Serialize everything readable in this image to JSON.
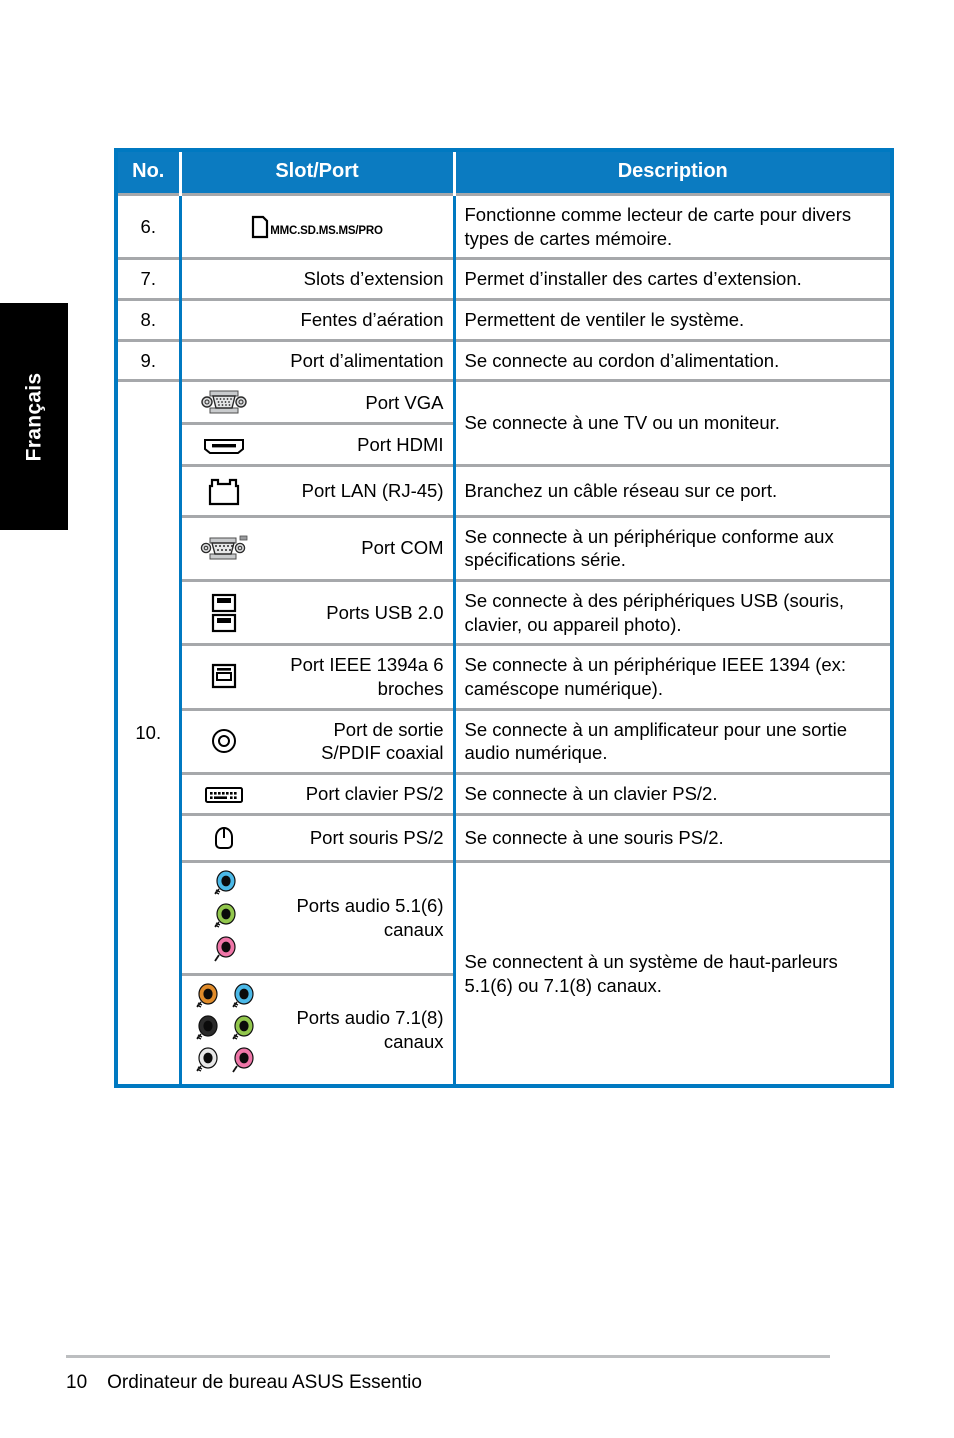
{
  "language_tab": {
    "label": "Français"
  },
  "table": {
    "headers": {
      "no": "No.",
      "slot_port": "Slot/Port",
      "description": "Description"
    },
    "accent_color": "#0079c1",
    "header_bg": "#0b7bc1",
    "divider_color": "#a6a8ab",
    "rows": [
      {
        "no": "6.",
        "icon": "memory-card-icon",
        "slot_port": "MMC.SD.MS.MS/PRO",
        "description": "Fonctionne comme lecteur de carte pour divers types de cartes mémoire."
      },
      {
        "no": "7.",
        "slot_port": "Slots d’extension",
        "description": "Permet d’installer des cartes d’extension."
      },
      {
        "no": "8.",
        "slot_port": "Fentes d’aération",
        "description": "Permettent de ventiler le système."
      },
      {
        "no": "9.",
        "slot_port": "Port d’alimentation",
        "description": "Se connecte au cordon d’alimentation."
      }
    ],
    "group_10": {
      "no": "10.",
      "ports": [
        {
          "icon": "vga-port-icon",
          "label": "Port VGA"
        },
        {
          "icon": "hdmi-port-icon",
          "label": "Port HDMI"
        },
        {
          "icon": "lan-port-icon",
          "label": "Port LAN (RJ-45)"
        },
        {
          "icon": "com-port-icon",
          "label": "Port COM"
        },
        {
          "icon": "usb-port-icon",
          "label": "Ports USB 2.0"
        },
        {
          "icon": "ieee1394-port-icon",
          "label": "Port IEEE 1394a 6 broches"
        },
        {
          "icon": "spdif-coaxial-icon",
          "label": "Port de sortie S/PDIF coaxial"
        },
        {
          "icon": "ps2-keyboard-icon",
          "label": "Port clavier PS/2"
        },
        {
          "icon": "ps2-mouse-icon",
          "label": "Port souris PS/2"
        },
        {
          "icon": "audio-5-1-icon",
          "label": "Ports audio 5.1(6) canaux"
        },
        {
          "icon": "audio-7-1-icon",
          "label": "Ports audio 7.1(8) canaux"
        }
      ],
      "descriptions": {
        "display": "Se connecte à une TV ou un moniteur.",
        "lan": "Branchez un câble réseau sur ce port.",
        "com": "Se connecte à un périphérique conforme aux spécifications série.",
        "usb": "Se connecte à des périphériques USB (souris, clavier, ou appareil photo).",
        "ieee1394": "Se connecte à un périphérique IEEE 1394 (ex: caméscope numérique).",
        "spdif": "Se connecte à un amplificateur pour une sortie audio numérique.",
        "keyboard": "Se connecte à un clavier PS/2.",
        "mouse": "Se connecte à une souris PS/2.",
        "audio": "Se connectent à un système de haut-parleurs 5.1(6) ou 7.1(8) canaux."
      }
    },
    "audio_colors": {
      "blue": "#4bb9e8",
      "green": "#92c74d",
      "pink": "#ef76a8",
      "orange": "#e08b2a",
      "black": "#2b2b2b",
      "gray": "#e8e8e8"
    }
  },
  "footer": {
    "page_number": "10",
    "title": "Ordinateur de bureau ASUS Essentio"
  }
}
